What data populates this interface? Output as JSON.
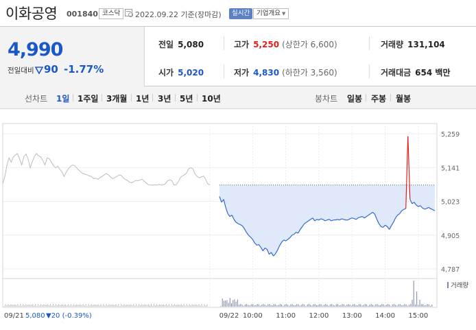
{
  "header": {
    "stock_name": "이화공영",
    "stock_code": "001840",
    "market": "코스닥",
    "date": "2022.09.22 기준(장마감)",
    "live_label": "실시간",
    "company_info_label": "기업개요"
  },
  "price": {
    "current": "4,990",
    "prev_label": "전일대비",
    "change": "90",
    "change_rate": "-1.77%"
  },
  "stats": {
    "prev": {
      "label": "전일",
      "value": "5,080"
    },
    "high": {
      "label": "고가",
      "value": "5,250",
      "sub": "(상한가 6,600)"
    },
    "volume": {
      "label": "거래량",
      "value": "131,104"
    },
    "open": {
      "label": "시가",
      "value": "5,020"
    },
    "low": {
      "label": "저가",
      "value": "4,830",
      "sub": "(하한가 3,560)"
    },
    "amount": {
      "label": "거래대금",
      "value": "654 백만"
    }
  },
  "period_bar": {
    "line_label": "선차트",
    "line_periods": [
      "1일",
      "1주일",
      "3개월",
      "1년",
      "3년",
      "5년",
      "10년"
    ],
    "active_period": "1일",
    "candle_label": "봉차트",
    "candle_periods": [
      "일봉",
      "주봉",
      "월봉"
    ]
  },
  "colors": {
    "accent_blue": "#1a57c9",
    "up_red": "#e4201a",
    "today_line": "#2f66d4",
    "today_fill": "#dfe9f9",
    "prev_line": "#bdbdbd"
  },
  "chart_data": {
    "type": "line",
    "prev_close": 5080,
    "ylim": [
      4787,
      5259
    ],
    "y_ticks": [
      "5,259",
      "5,141",
      "5,023",
      "4,905",
      "4,787"
    ],
    "y_tick_values": [
      5259,
      5141,
      5023,
      4905,
      4787
    ],
    "x_ticks": [
      "09/22",
      "10:00",
      "11:00",
      "12:00",
      "13:00",
      "14:00",
      "15:00"
    ],
    "x_tick_times": [
      540,
      600,
      660,
      720,
      780,
      840,
      900
    ],
    "volume_label": "거래량",
    "footer": {
      "date": "09/21",
      "close": "5,080",
      "change": "▼20 (-0.39%)"
    },
    "series": [
      {
        "name": "09/21",
        "time_range": [
          540,
          930
        ],
        "values": [
          5085,
          5110,
          5150,
          5175,
          5160,
          5178,
          5185,
          5190,
          5170,
          5150,
          5180,
          5188,
          5170,
          5140,
          5162,
          5180,
          5190,
          5182,
          5178,
          5165,
          5150,
          5175,
          5172,
          5160,
          5148,
          5140,
          5146,
          5135,
          5126,
          5110,
          5124,
          5136,
          5145,
          5150,
          5148,
          5140,
          5132,
          5125,
          5120,
          5118,
          5115,
          5112,
          5110,
          5102,
          5104,
          5100,
          5106,
          5110,
          5115,
          5120,
          5116,
          5108,
          5102,
          5106,
          5110,
          5115,
          5114,
          5105,
          5100,
          5096,
          5090,
          5088,
          5092,
          5096,
          5095,
          5098,
          5100,
          5093,
          5086,
          5081,
          5080,
          5080,
          5081,
          5080,
          5082,
          5080,
          5081,
          5085,
          5095,
          5098,
          5095,
          5080,
          5081,
          5090,
          5106,
          5112,
          5116,
          5122,
          5138,
          5140,
          5136,
          5118,
          5110,
          5106,
          5108,
          5112,
          5100,
          5084,
          5080
        ]
      },
      {
        "name": "09/22",
        "time_range": [
          540,
          930
        ],
        "values": [
          5040,
          5020,
          5030,
          5002,
          4980,
          4970,
          4975,
          4960,
          4950,
          4945,
          4942,
          4938,
          4928,
          4915,
          4905,
          4898,
          4890,
          4878,
          4870,
          4872,
          4862,
          4850,
          4860,
          4855,
          4838,
          4845,
          4832,
          4840,
          4852,
          4868,
          4880,
          4888,
          4885,
          4890,
          4896,
          4905,
          4908,
          4915,
          4912,
          4925,
          4935,
          4945,
          4950,
          4955,
          4960,
          4965,
          4955,
          4960,
          4958,
          4962,
          4960,
          4955,
          4958,
          4960,
          4955,
          4958,
          4958,
          4960,
          4958,
          4962,
          4960,
          4958,
          4958,
          4962,
          4965,
          4963,
          4960,
          4966,
          4968,
          4970,
          4965,
          4970,
          4975,
          4980,
          4985,
          4978,
          4960,
          4945,
          4935,
          4932,
          4940,
          4935,
          4925,
          4938,
          4950,
          4965,
          4975,
          4980,
          4990,
          4995,
          4998,
          5250,
          5030,
          5015,
          5020,
          5010,
          5005,
          5008,
          5000,
          4996,
          4998,
          5002,
          4997,
          4994,
          4990
        ]
      }
    ]
  }
}
